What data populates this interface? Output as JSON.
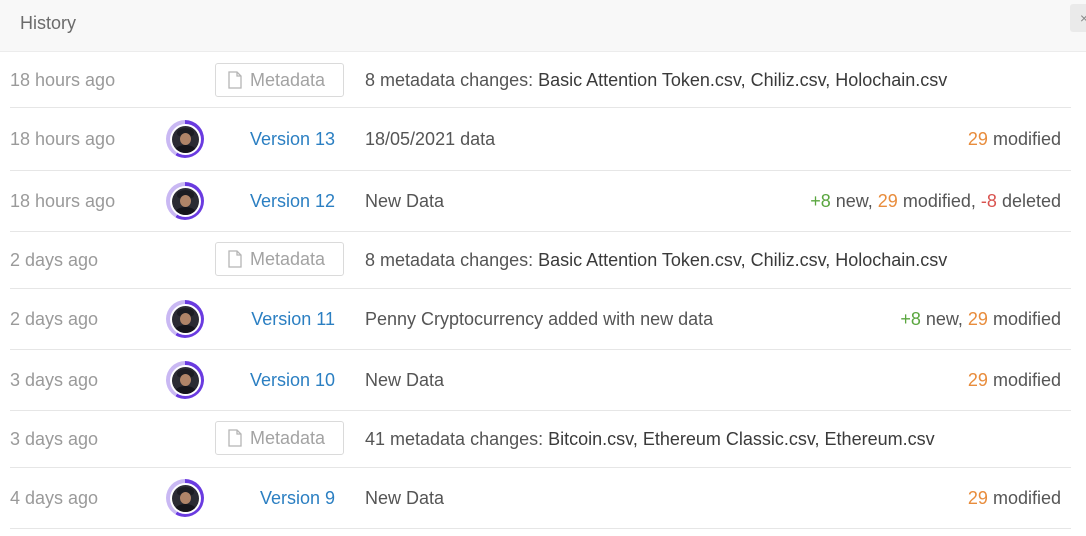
{
  "header": {
    "title": "History",
    "close_label": "×"
  },
  "rows": [
    {
      "type": "metadata",
      "time": "18 hours ago",
      "badge_label": "Metadata",
      "desc_prefix": "8 metadata changes: ",
      "desc_files": "Basic Attention Token.csv, Chiliz.csv, Holochain.csv"
    },
    {
      "type": "version",
      "time": "18 hours ago",
      "version": "Version 13",
      "desc": "18/05/2021 data",
      "changes": {
        "new": "",
        "new_label": "",
        "modified": "29",
        "modified_label": "modified",
        "deleted": "",
        "deleted_label": ""
      }
    },
    {
      "type": "version",
      "time": "18 hours ago",
      "version": "Version 12",
      "desc": "New Data",
      "changes": {
        "new": "+8",
        "new_label": "new,",
        "modified": "29",
        "modified_label": "modified,",
        "deleted": "-8",
        "deleted_label": "deleted"
      }
    },
    {
      "type": "metadata",
      "time": "2 days ago",
      "badge_label": "Metadata",
      "desc_prefix": "8 metadata changes: ",
      "desc_files": "Basic Attention Token.csv, Chiliz.csv, Holochain.csv"
    },
    {
      "type": "version",
      "time": "2 days ago",
      "version": "Version 11",
      "desc": "Penny Cryptocurrency added with new data",
      "changes": {
        "new": "+8",
        "new_label": "new,",
        "modified": "29",
        "modified_label": "modified",
        "deleted": "",
        "deleted_label": ""
      }
    },
    {
      "type": "version",
      "time": "3 days ago",
      "version": "Version 10",
      "desc": "New Data",
      "changes": {
        "new": "",
        "new_label": "",
        "modified": "29",
        "modified_label": "modified",
        "deleted": "",
        "deleted_label": ""
      }
    },
    {
      "type": "metadata",
      "time": "3 days ago",
      "badge_label": "Metadata",
      "desc_prefix": "41 metadata changes: ",
      "desc_files": "Bitcoin.csv, Ethereum Classic.csv, Ethereum.csv"
    },
    {
      "type": "version",
      "time": "4 days ago",
      "version": "Version 9",
      "desc": "New Data",
      "changes": {
        "new": "",
        "new_label": "",
        "modified": "29",
        "modified_label": "modified",
        "deleted": "",
        "deleted_label": ""
      }
    }
  ],
  "colors": {
    "version_link": "#2b7fc2",
    "new": "#5aa63f",
    "modified": "#e88c3c",
    "deleted": "#d9534f",
    "avatar_ring": "#6a3be0"
  },
  "icons": {
    "metadata": "document-icon",
    "avatar": "user-avatar",
    "close": "close-icon"
  }
}
